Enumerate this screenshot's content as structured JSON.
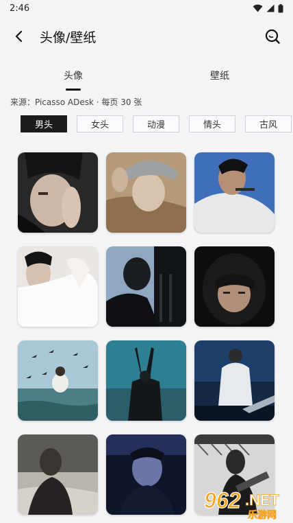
{
  "status_bar": {
    "time": "2:46"
  },
  "app_bar": {
    "title": "头像/壁纸"
  },
  "tabs": [
    {
      "label": "头像",
      "active": true
    },
    {
      "label": "壁纸",
      "active": false
    }
  ],
  "source_line": "来源：Picasso ADesk · 每页 30 张",
  "categories": [
    {
      "label": "男头",
      "active": true
    },
    {
      "label": "女头",
      "active": false
    },
    {
      "label": "动漫",
      "active": false
    },
    {
      "label": "情头",
      "active": false
    },
    {
      "label": "古风",
      "active": false
    }
  ],
  "images": [
    {
      "subject": "boy in black beanie, hand near face"
    },
    {
      "subject": "boy in grey bucket hat"
    },
    {
      "subject": "boy in white tank top, blue sky"
    },
    {
      "subject": "boy with white cloth, light backdrop"
    },
    {
      "subject": "silhouette against blue window"
    },
    {
      "subject": "boy with dark helmet visor"
    },
    {
      "subject": "boy in sea with flying birds"
    },
    {
      "subject": "silhouette raising arms at dusk"
    },
    {
      "subject": "boy in white shirt at sea"
    },
    {
      "subject": "boy by water, black and white"
    },
    {
      "subject": "boy in dark blue light"
    },
    {
      "subject": "boy with guitar, monochrome"
    }
  ],
  "watermark": {
    "brand_number": "962",
    "suffix": ".NET",
    "sub_text": "乐游网"
  },
  "colors": {
    "background": "#f3f4f6",
    "chip_active": "#1c1c1c",
    "watermark_orange": "#f5a21c"
  }
}
